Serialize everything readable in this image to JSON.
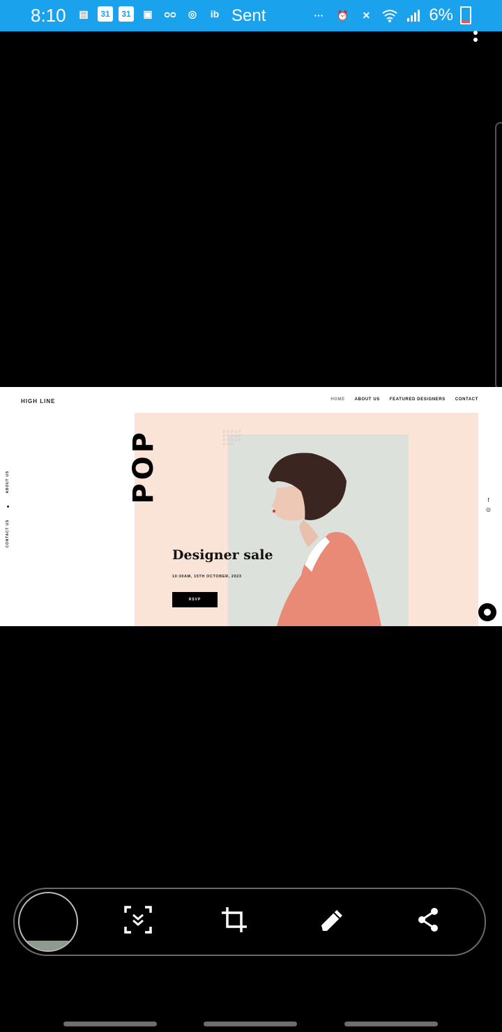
{
  "status_bar": {
    "time": "8:10",
    "sent_label": "Sent",
    "battery": "6%",
    "icons": [
      "messages-icon",
      "calendar-icon",
      "calendar-icon",
      "webtoon-icon",
      "voicemail-icon",
      "instagram-icon",
      "ib-icon",
      "pinterest-icon",
      "instagram-icon",
      "tag-icon",
      "more-icon",
      "alarm-icon",
      "mute-icon",
      "wifi-icon",
      "signal-icon",
      "battery-icon"
    ],
    "calendar_day": "31",
    "ib_text": "ib"
  },
  "site": {
    "logo": "HIGH LINE",
    "nav": [
      "HOME",
      "ABOUT US",
      "FEATURED DESIGNERS",
      "CONTACT"
    ],
    "side_links": [
      "ABOUT US",
      "CONTACT US"
    ],
    "pop_text": "POP",
    "popup_grid": [
      "POPUP",
      "POPUP",
      "POPUP",
      "POP"
    ],
    "headline": "Designer sale",
    "event_date": "10:30AM, 15TH OCTOBER, 2023",
    "rsvp": "RSVP",
    "social": [
      "f",
      "◎"
    ]
  },
  "toolbar": {
    "buttons": [
      "scroll-capture",
      "crop",
      "draw",
      "share"
    ]
  },
  "colors": {
    "status_bar": "#1aa3ec",
    "hero_peach": "#f9e4d7",
    "hero_panel": "#dde1db",
    "coat": "#e98a76"
  }
}
